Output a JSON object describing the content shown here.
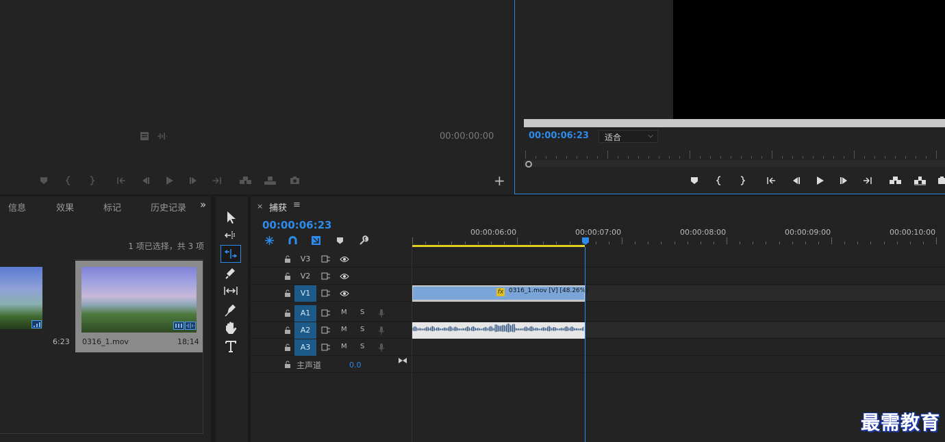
{
  "source_monitor": {
    "timecode": "00:00:00:00",
    "add_label": "+"
  },
  "program_monitor": {
    "timecode": "00:00:06:23",
    "zoom_select": "适合"
  },
  "project_panel": {
    "tabs": [
      "信息",
      "效果",
      "标记",
      "历史记录"
    ],
    "overflow": "»",
    "selection_info": "1 项已选择，共 3 项",
    "clips": [
      {
        "name": "",
        "duration": "6:23"
      },
      {
        "name": "0316_1.mov",
        "duration": "18;14"
      }
    ]
  },
  "timeline": {
    "close": "×",
    "title": "捕获",
    "menu": "≡",
    "timecode": "00:00:06:23",
    "ruler_labels": [
      "00:00:06:00",
      "00:00:07:00",
      "00:00:08:00",
      "00:00:09:00",
      "00:00:10:00"
    ],
    "video_tracks": [
      "V3",
      "V2",
      "V1"
    ],
    "audio_tracks": [
      "A1",
      "A2",
      "A3"
    ],
    "mute_label": "M",
    "solo_label": "S",
    "master": {
      "label": "主声道",
      "value": "0.0"
    },
    "video_clip": {
      "fx": "fx",
      "label": "0316_1.mov [V] [48.26%]"
    }
  },
  "watermark": "最需教育",
  "colors": {
    "accent": "#2d8ceb",
    "panel": "#232323",
    "track_active": "#1c5a8a",
    "clip_video": "#7aa5d8",
    "work_area": "#e0d020"
  }
}
